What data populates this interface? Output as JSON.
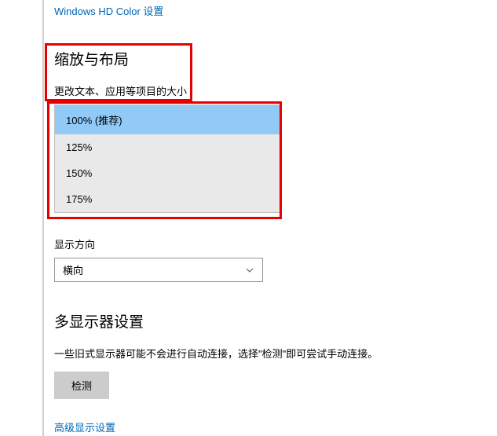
{
  "links": {
    "hd_color": "Windows HD Color 设置",
    "advanced_display": "高级显示设置"
  },
  "scale_section": {
    "title": "缩放与布局",
    "label": "更改文本、应用等项目的大小",
    "options": [
      "100% (推荐)",
      "125%",
      "150%",
      "175%"
    ]
  },
  "orientation": {
    "label": "显示方向",
    "value": "横向"
  },
  "multi_monitor": {
    "title": "多显示器设置",
    "desc": "一些旧式显示器可能不会进行自动连接，选择\"检测\"即可尝试手动连接。",
    "detect_button": "检测"
  }
}
